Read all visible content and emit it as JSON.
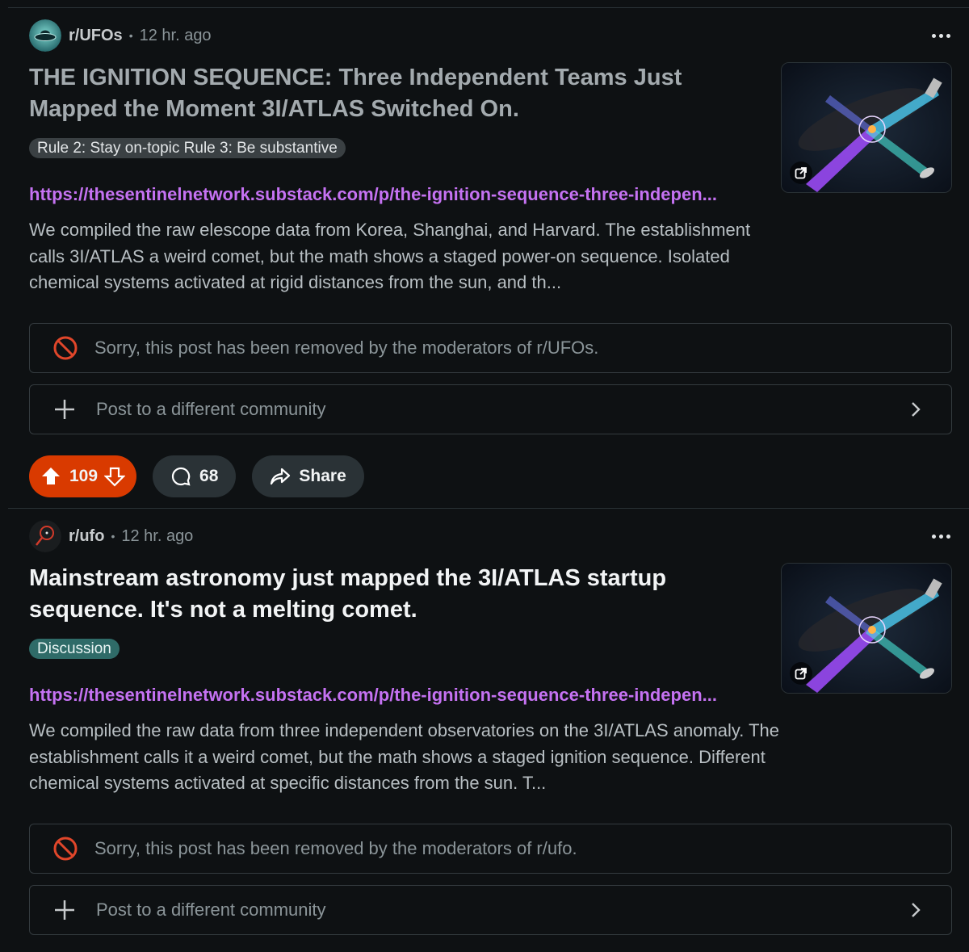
{
  "posts": [
    {
      "subreddit": "r/UFOs",
      "separator": "•",
      "time": "12 hr. ago",
      "title": "THE IGNITION SEQUENCE: Three Independent Teams Just Mapped the Moment 3I/ATLAS Switched On.",
      "flair": "Rule 2: Stay on-topic Rule 3: Be substantive",
      "link": "https://thesentinelnetwork.substack.com/p/the-ignition-sequence-three-indepen...",
      "body": "We compiled the raw elescope data from Korea, Shanghai, and Harvard. The establishment calls 3I/ATLAS a weird comet, but the math shows a staged power-on sequence. Isolated chemical systems activated at rigid distances from the sun, and th...",
      "removed_notice": "Sorry, this post has been removed by the moderators of r/UFOs.",
      "repost_label": "Post to a different community",
      "votes": "109",
      "comments": "68",
      "share_label": "Share"
    },
    {
      "subreddit": "r/ufo",
      "separator": "•",
      "time": "12 hr. ago",
      "title": "Mainstream astronomy just mapped the 3I/ATLAS startup sequence. It's not a melting comet.",
      "flair": "Discussion",
      "link": "https://thesentinelnetwork.substack.com/p/the-ignition-sequence-three-indepen...",
      "body": "We compiled the raw data from three independent observatories on the 3I/ATLAS anomaly. The establishment calls it a weird comet, but the math shows a staged ignition sequence. Different chemical systems activated at specific distances from the sun. T...",
      "removed_notice": "Sorry, this post has been removed by the moderators of r/ufo.",
      "repost_label": "Post to a different community"
    }
  ],
  "colors": {
    "background": "#0e1113",
    "upvote_pill": "#d93a00",
    "link": "#c572f2",
    "removed_icon": "#e0462a",
    "flair_teal": "#2f6b68"
  }
}
